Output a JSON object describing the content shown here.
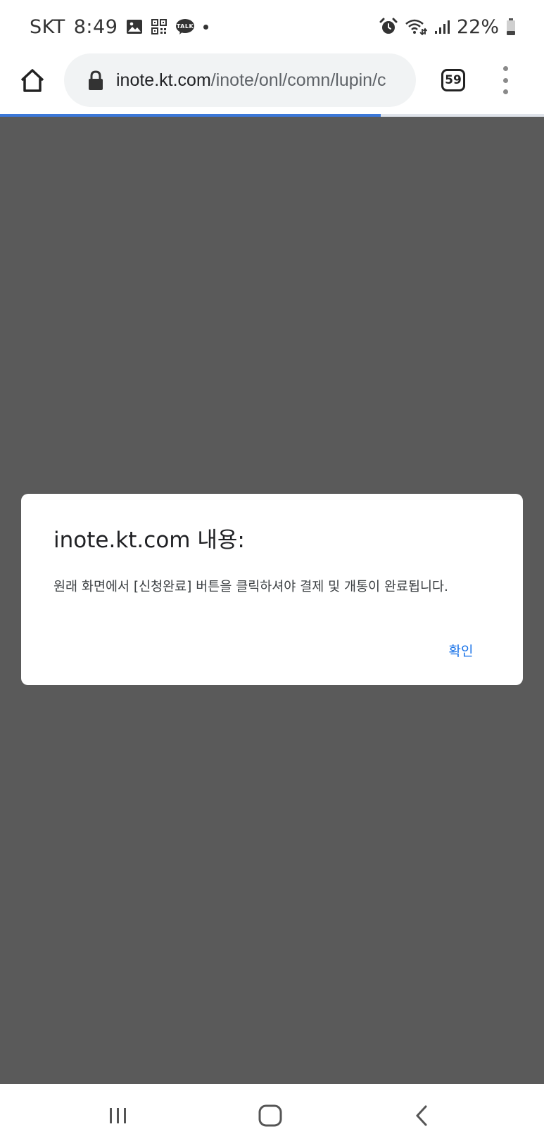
{
  "status_bar": {
    "carrier": "SKT",
    "time": "8:49",
    "battery": "22%",
    "left_icons": [
      "image-icon",
      "qr-code-icon",
      "kakaotalk-icon"
    ],
    "kakao_label": "TALK",
    "right_icons": [
      "alarm-icon",
      "wifi-icon",
      "signal-icon",
      "battery-icon"
    ]
  },
  "browser": {
    "url_host": "inote.kt.com",
    "url_path": "/inote/onl/comn/lupin/c",
    "tab_count": "59",
    "page_load_progress": 0.7
  },
  "dialog": {
    "title": "inote.kt.com 내용:",
    "message": "원래 화면에서 [신청완료] 버튼을 클릭하셔야 결제 및 개통이 완료됩니다.",
    "ok_label": "확인"
  },
  "colors": {
    "accent": "#1a73e8",
    "progress": "#3c78d8",
    "overlay": "#5a5a5a"
  },
  "nav_bar": {
    "buttons": [
      "recent-apps-icon",
      "home-icon",
      "back-icon"
    ]
  }
}
